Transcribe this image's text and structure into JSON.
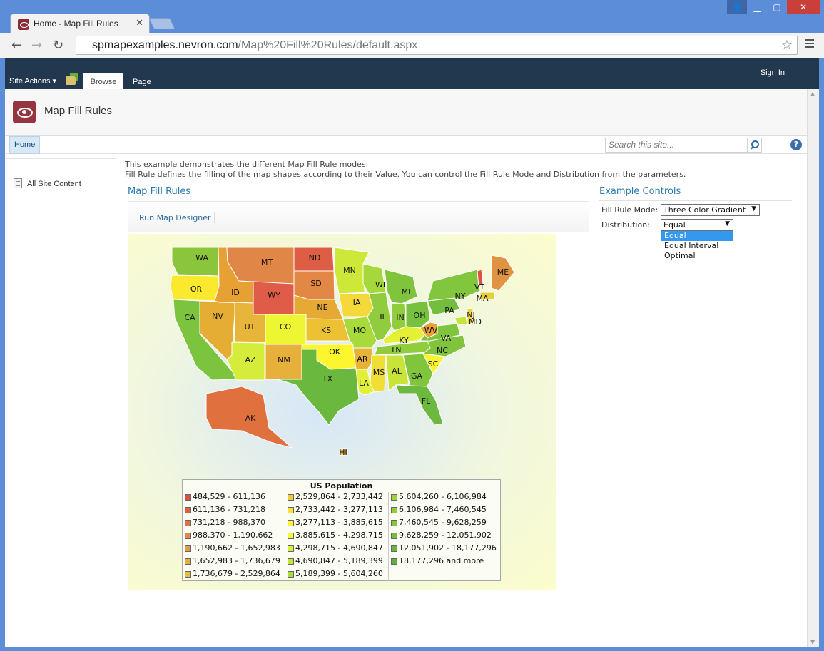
{
  "browser": {
    "tab_title": "Home - Map Fill Rules",
    "url_host": "spmapexamples.nevron.com",
    "url_path": "/Map%20Fill%20Rules/default.aspx"
  },
  "ribbon": {
    "site_actions": "Site Actions",
    "tabs": [
      "Browse",
      "Page"
    ],
    "sign_in": "Sign In"
  },
  "site": {
    "title": "Map Fill Rules",
    "nav_home": "Home",
    "search_placeholder": "Search this site..."
  },
  "left_nav": {
    "all_site_content": "All Site Content"
  },
  "description": {
    "line1": "This example demonstrates the different Map Fill Rule modes.",
    "line2": "Fill Rule defines the filling of the map shapes according to their Value. You can control the Fill Rule Mode and Distribution from the parameters."
  },
  "webpart": {
    "title": "Map Fill Rules",
    "run_designer": "Run Map Designer"
  },
  "map": {
    "states": [
      "WA",
      "OR",
      "CA",
      "NV",
      "ID",
      "MT",
      "WY",
      "UT",
      "AZ",
      "CO",
      "NM",
      "ND",
      "SD",
      "NE",
      "KS",
      "OK",
      "TX",
      "MN",
      "IA",
      "MO",
      "AR",
      "LA",
      "WI",
      "IL",
      "MI",
      "IN",
      "OH",
      "KY",
      "TN",
      "MS",
      "AL",
      "GA",
      "FL",
      "SC",
      "NC",
      "VA",
      "WV",
      "PA",
      "NY",
      "MD",
      "NJ",
      "VT",
      "MA",
      "ME",
      "AK",
      "HI"
    ],
    "legend": {
      "title": "US Population",
      "col1": [
        {
          "label": "484,529 - 611,136",
          "color": "#d9503c"
        },
        {
          "label": "611,136 - 731,218",
          "color": "#dc5f3e"
        },
        {
          "label": "731,218 - 988,370",
          "color": "#e07342"
        },
        {
          "label": "988,370 - 1,190,662",
          "color": "#e28745"
        },
        {
          "label": "1,190,662 - 1,652,983",
          "color": "#e49a46"
        },
        {
          "label": "1,652,983 - 1,736,679",
          "color": "#e6ad40"
        },
        {
          "label": "1,736,679 - 2,529,864",
          "color": "#e8bf3a"
        }
      ],
      "col2": [
        {
          "label": "2,529,864 - 2,733,442",
          "color": "#f0cc3a"
        },
        {
          "label": "2,733,442 - 3,277,113",
          "color": "#f7e23a"
        },
        {
          "label": "3,277,113 - 3,885,615",
          "color": "#fdf53a"
        },
        {
          "label": "3,885,615 - 4,298,715",
          "color": "#f2f93a"
        },
        {
          "label": "4,298,715 - 4,690,847",
          "color": "#d8ee38"
        },
        {
          "label": "4,690,847 - 5,189,399",
          "color": "#c2e636"
        },
        {
          "label": "5,189,399 - 5,604,260",
          "color": "#acdd36"
        }
      ],
      "col3": [
        {
          "label": "5,604,260 - 6,106,984",
          "color": "#9ed536"
        },
        {
          "label": "6,106,984 - 7,460,545",
          "color": "#90cd38"
        },
        {
          "label": "7,460,545 - 9,628,259",
          "color": "#82c63a"
        },
        {
          "label": "9,628,259 - 12,051,902",
          "color": "#74be3c"
        },
        {
          "label": "12,051,902 - 18,177,296",
          "color": "#68b63e"
        },
        {
          "label": "18,177,296 and more",
          "color": "#5eae40"
        }
      ]
    }
  },
  "controls": {
    "title": "Example Controls",
    "fill_rule_label": "Fill Rule Mode:",
    "fill_rule_value": "Three Color Gradient",
    "distribution_label": "Distribution:",
    "distribution_value": "Equal",
    "distribution_options": [
      "Equal",
      "Equal Interval",
      "Optimal"
    ]
  }
}
